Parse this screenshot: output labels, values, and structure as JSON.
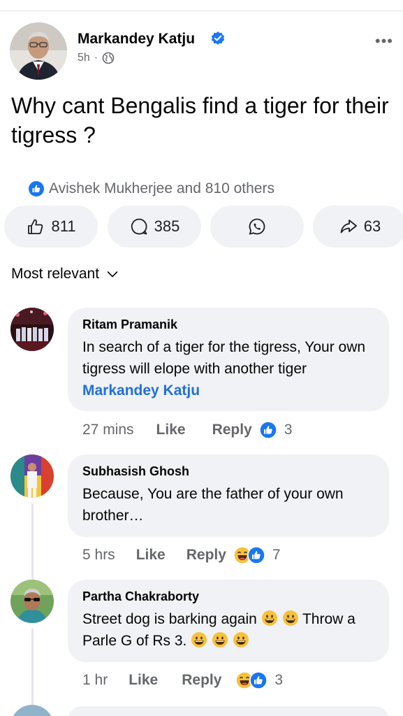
{
  "post": {
    "author": "Markandey Katju",
    "time": "5h",
    "separator": "·",
    "more": "•••",
    "text": "Why cant Bengalis find a tiger for their tigress ?"
  },
  "reactions": {
    "summary": "Avishek Mukherjee and 810 others"
  },
  "actions": {
    "likes": "811",
    "comments": "385",
    "shares": "63"
  },
  "sort": {
    "label": "Most relevant"
  },
  "comments": [
    {
      "name": "Ritam Pramanik",
      "text": "In search of a tiger for the tigress, Your own tigress will elope with another tiger",
      "tag": "Markandey Katju",
      "time": "27 mins",
      "like": "Like",
      "reply": "Reply",
      "count": "3"
    },
    {
      "name": "Subhasish Ghosh",
      "text": "Because, You are the father of your own brother…",
      "time": "5 hrs",
      "like": "Like",
      "reply": "Reply",
      "count": "7"
    },
    {
      "name": "Partha Chakraborty",
      "text_a": "Street dog is barking again",
      "text_b": "Throw a Parle G of Rs 3.",
      "time": "1 hr",
      "like": "Like",
      "reply": "Reply",
      "count": "3"
    }
  ],
  "colors": {
    "accent": "#216fdb",
    "like_blue": "#1877f2",
    "pill_bg": "#f0f2f5",
    "muted": "#65676b"
  },
  "icons": [
    "verified-badge-icon",
    "globe-icon",
    "like-icon",
    "comment-icon",
    "whatsapp-icon",
    "share-icon",
    "chevron-down-icon",
    "laugh-reaction-icon",
    "grinning-emoji-icon"
  ]
}
